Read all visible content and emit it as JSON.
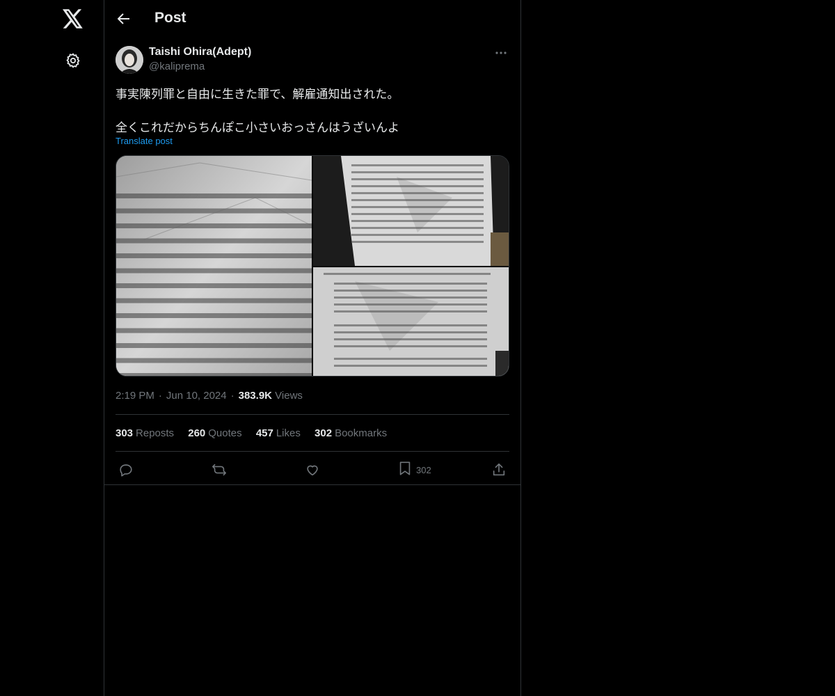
{
  "header": {
    "title": "Post"
  },
  "author": {
    "name": "Taishi Ohira(Adept)",
    "handle": "@kaliprema"
  },
  "post": {
    "line1": "事実陳列罪と自由に生きた罪で、解雇通知出された。",
    "line2": "全くこれだからちんぽこ小さいおっさんはうざいんよ",
    "translate": "Translate post"
  },
  "meta": {
    "time": "2:19 PM",
    "date": "Jun 10, 2024",
    "views": "383.9K",
    "views_label": "Views"
  },
  "stats": {
    "reposts": "303",
    "reposts_label": "Reposts",
    "quotes": "260",
    "quotes_label": "Quotes",
    "likes": "457",
    "likes_label": "Likes",
    "bookmarks": "302",
    "bookmarks_label": "Bookmarks"
  },
  "actions": {
    "bookmark_count": "302"
  },
  "colors": {
    "background": "#000000",
    "text": "#e7e9ea",
    "muted": "#71767b",
    "accent": "#1d9bf0",
    "border": "#2f3336"
  },
  "icons": [
    "x-logo-icon",
    "gear-icon",
    "back-arrow-icon",
    "more-icon",
    "reply-icon",
    "repost-icon",
    "like-icon",
    "bookmark-icon",
    "share-icon"
  ]
}
